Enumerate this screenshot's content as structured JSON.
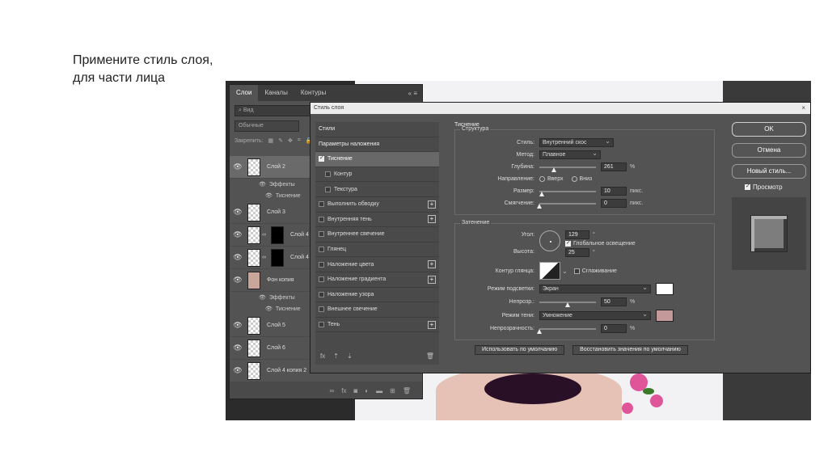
{
  "slide": {
    "title_line1": "Примените стиль слоя,",
    "title_line2": "для части лица"
  },
  "layers_panel": {
    "tabs": [
      "Слои",
      "Каналы",
      "Контуры"
    ],
    "tab_controls": "«  ≡",
    "filter_label": "Вид",
    "blend_mode": "Обычные",
    "lock_label": "Закрепить:",
    "layers": [
      {
        "name": "Слой 2",
        "selected": true
      },
      {
        "name": "Эффекты",
        "type": "effects"
      },
      {
        "name": "Тиснение",
        "type": "effect"
      },
      {
        "name": "Слой 3"
      },
      {
        "name": "Слой 4 к"
      },
      {
        "name": "Слой 4 к"
      },
      {
        "name": "Фон копия"
      },
      {
        "name": "Эффекты",
        "type": "effects"
      },
      {
        "name": "Тиснение",
        "type": "effect"
      },
      {
        "name": "Слой 5"
      },
      {
        "name": "Слой 6"
      },
      {
        "name": "Слой 4 копия 2"
      }
    ],
    "bottom_icons": [
      "link-icon",
      "fx-icon",
      "mask-icon",
      "adjustment-icon",
      "folder-icon",
      "new-layer-icon",
      "trash-icon"
    ]
  },
  "dialog": {
    "title": "Стиль слоя",
    "close": "×",
    "styles_list": [
      {
        "label": "Стили",
        "kind": "header"
      },
      {
        "label": "Параметры наложения",
        "kind": "header"
      },
      {
        "label": "Тиснение",
        "checked": true,
        "active": true
      },
      {
        "label": "Контур",
        "sub": true,
        "checked": false
      },
      {
        "label": "Текстура",
        "sub": true,
        "checked": false
      },
      {
        "label": "Выполнить обводку",
        "checked": false,
        "plus": true
      },
      {
        "label": "Внутренняя тень",
        "checked": false,
        "plus": true
      },
      {
        "label": "Внутреннее свечение",
        "checked": false
      },
      {
        "label": "Глянец",
        "checked": false
      },
      {
        "label": "Наложение цвета",
        "checked": false,
        "plus": true
      },
      {
        "label": "Наложение градиента",
        "checked": false,
        "plus": true
      },
      {
        "label": "Наложение узора",
        "checked": false
      },
      {
        "label": "Внешнее свечение",
        "checked": false
      },
      {
        "label": "Тень",
        "checked": false,
        "plus": true
      }
    ],
    "fx_bar": {
      "fx": "fx",
      "up": "⇡",
      "down": "⇣",
      "trash": "🗑"
    },
    "emboss": {
      "section_title": "Тиснение",
      "structure_title": "Структура",
      "style_label": "Стиль:",
      "style_value": "Внутренний скос",
      "method_label": "Метод:",
      "method_value": "Плавное",
      "depth_label": "Глубина:",
      "depth_value": "261",
      "depth_unit": "%",
      "depth_fraction": 0.26,
      "direction_label": "Направление:",
      "direction_up": "Вверх",
      "direction_down": "Вниз",
      "size_label": "Размер:",
      "size_value": "10",
      "size_unit": "пикс.",
      "size_fraction": 0.04,
      "soften_label": "Смягчение:",
      "soften_value": "0",
      "soften_unit": "пикс.",
      "soften_fraction": 0.0
    },
    "shading": {
      "title": "Затенение",
      "angle_label": "Угол:",
      "angle_value": "129",
      "angle_unit": "°",
      "global_light_label": "Глобальное освещение",
      "altitude_label": "Высота:",
      "altitude_value": "25",
      "altitude_unit": "°",
      "gloss_contour_label": "Контур глянца:",
      "antialias_label": "Сглаживание",
      "highlight_mode_label": "Режим подсветки:",
      "highlight_mode_value": "Экран",
      "highlight_color": "#ffffff",
      "highlight_opacity_label": "Непрозр.:",
      "highlight_opacity_value": "50",
      "highlight_opacity_unit": "%",
      "highlight_opacity_fraction": 0.5,
      "shadow_mode_label": "Режим тени:",
      "shadow_mode_value": "Умножение",
      "shadow_color": "#c4999a",
      "shadow_opacity_label": "Непрозрачность:",
      "shadow_opacity_value": "0",
      "shadow_opacity_unit": "%",
      "shadow_opacity_fraction": 0.0
    },
    "buttons": {
      "make_default": "Использовать по умолчанию",
      "reset_default": "Восстановить значения по умолчанию",
      "ok": "OK",
      "cancel": "Отмена",
      "new_style": "Новый стиль...",
      "preview": "Просмотр"
    }
  }
}
